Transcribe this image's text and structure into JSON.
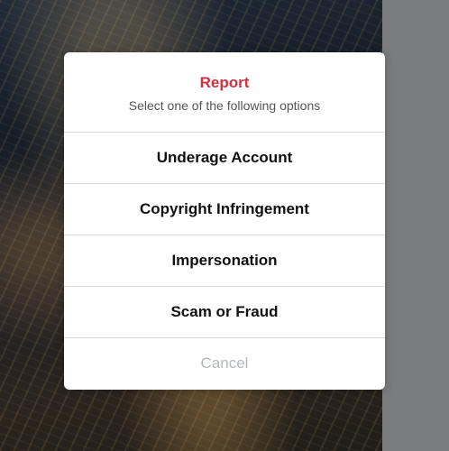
{
  "dialog": {
    "title": "Report",
    "subtitle": "Select one of the following options",
    "options": [
      {
        "label": "Underage Account"
      },
      {
        "label": "Copyright Infringement"
      },
      {
        "label": "Impersonation"
      },
      {
        "label": "Scam or Fraud"
      }
    ],
    "cancel_label": "Cancel"
  },
  "colors": {
    "title": "#d1313f",
    "cancel": "#b3b6bc",
    "overlay": "#7b7c7e"
  }
}
